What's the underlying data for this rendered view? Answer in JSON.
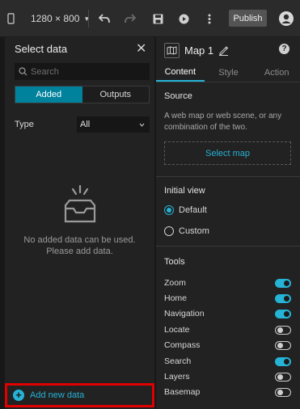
{
  "toolbar": {
    "resolution": "1280 × 800",
    "publish_label": "Publish",
    "icons": [
      "device-icon",
      "chevron-down-icon",
      "undo-icon",
      "redo-icon",
      "save-icon",
      "preview-icon",
      "more-vertical-icon",
      "avatar-icon"
    ]
  },
  "select_data": {
    "title": "Select data",
    "search_placeholder": "Search",
    "tabs": [
      {
        "label": "Added",
        "active": true
      },
      {
        "label": "Outputs",
        "active": false
      }
    ],
    "type_label": "Type",
    "type_value": "All",
    "empty_text_line1": "No added data can be used.",
    "empty_text_line2": "Please add data.",
    "add_new_data_label": "Add new data"
  },
  "settings": {
    "widget_title": "Map 1",
    "tabs": [
      {
        "label": "Content",
        "active": true
      },
      {
        "label": "Style",
        "active": false
      },
      {
        "label": "Action",
        "active": false
      }
    ],
    "source": {
      "title": "Source",
      "description": "A web map or web scene, or any combination of the two.",
      "select_map_label": "Select map"
    },
    "initial_view": {
      "title": "Initial view",
      "options": [
        {
          "label": "Default",
          "checked": true
        },
        {
          "label": "Custom",
          "checked": false
        }
      ]
    },
    "tools": {
      "title": "Tools",
      "items": [
        {
          "label": "Zoom",
          "on": true
        },
        {
          "label": "Home",
          "on": true
        },
        {
          "label": "Navigation",
          "on": true
        },
        {
          "label": "Locate",
          "on": false
        },
        {
          "label": "Compass",
          "on": false
        },
        {
          "label": "Search",
          "on": true
        },
        {
          "label": "Layers",
          "on": false
        },
        {
          "label": "Basemap",
          "on": false
        }
      ]
    }
  },
  "colors": {
    "accent": "#25b3d6",
    "active_tab": "#00819c",
    "highlight": "#e00000"
  }
}
